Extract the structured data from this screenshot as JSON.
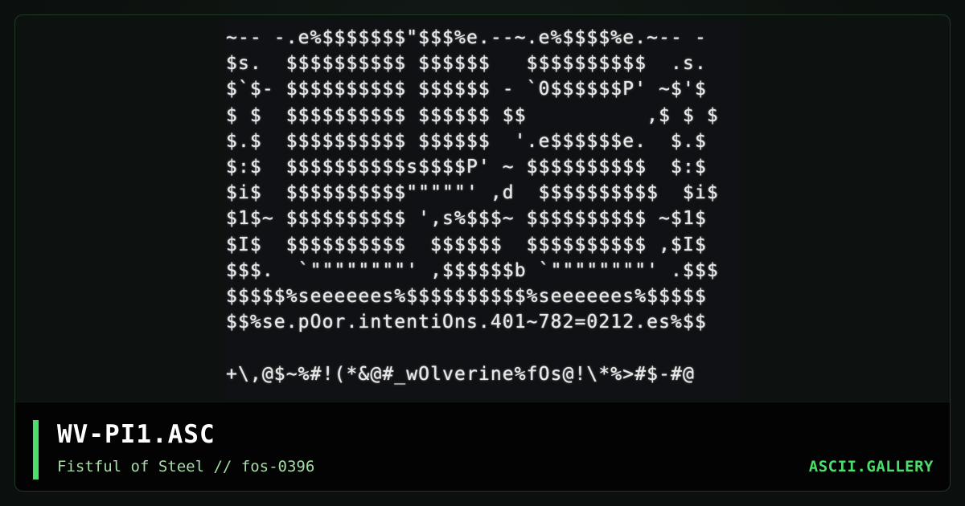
{
  "art": {
    "lines": [
      "~-- -.e%$$$$$$$\"$$$%e.--~.e%$$$$%e.~-- -",
      "$s.  $$$$$$$$$$ $$$$$$   $$$$$$$$$$  .s.",
      "$`$- $$$$$$$$$$ $$$$$$ - `0$$$$$$P' ~$'$",
      "$ $  $$$$$$$$$$ $$$$$$ $$          ,$ $ $",
      "$.$  $$$$$$$$$$ $$$$$$  '.e$$$$$$e.  $.$",
      "$:$  $$$$$$$$$$s$$$$P' ~ $$$$$$$$$$  $:$",
      "$i$  $$$$$$$$$$\"\"\"\"\"' ,d  $$$$$$$$$$  $i$",
      "$1$~ $$$$$$$$$$ ',s%$$$~ $$$$$$$$$$ ~$1$",
      "$I$  $$$$$$$$$$  $$$$$$  $$$$$$$$$$ ,$I$",
      "$$$.  `\"\"\"\"\"\"\"\"' ,$$$$$$b `\"\"\"\"\"\"\"\"' .$$$",
      "$$$$$%seeeeees%$$$$$$$$$$%seeeeees%$$$$$",
      "$$%se.pOor.intentiOns.401~782=0212.es%$$",
      "",
      "+\\,@$~%#!(*&@#_wOlverine%fOs@!\\*%>#$-#@"
    ]
  },
  "footer": {
    "title": "WV-PI1.ASC",
    "subtitle": "Fistful of Steel // fos-0396",
    "brand": "ASCII.GALLERY"
  },
  "colors": {
    "accent": "#4ade6b",
    "background": "#0b0f0d",
    "art_text": "#e8e8e8",
    "subtitle": "#a7dca8"
  }
}
